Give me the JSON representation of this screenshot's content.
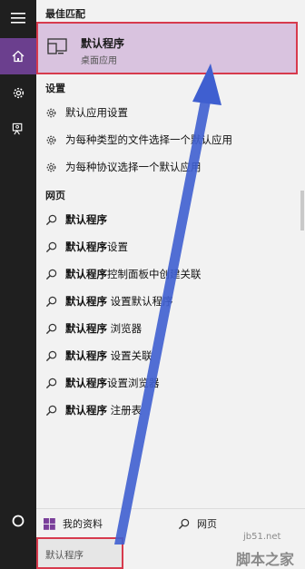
{
  "best_match": {
    "heading": "最佳匹配",
    "title": "默认程序",
    "subtitle": "桌面应用"
  },
  "settings": {
    "heading": "设置",
    "items": [
      {
        "label": "默认应用设置"
      },
      {
        "label": "为每种类型的文件选择一个默认应用"
      },
      {
        "label": "为每种协议选择一个默认应用"
      }
    ]
  },
  "web": {
    "heading": "网页",
    "items": [
      {
        "bold": "默认程序",
        "rest": ""
      },
      {
        "bold": "默认程序",
        "rest": "设置"
      },
      {
        "bold": "默认程序",
        "rest": "控制面板中创建关联"
      },
      {
        "bold": "默认程序",
        "rest": " 设置默认程序"
      },
      {
        "bold": "默认程序",
        "rest": " 浏览器"
      },
      {
        "bold": "默认程序",
        "rest": " 设置关联"
      },
      {
        "bold": "默认程序",
        "rest": "设置浏览器"
      },
      {
        "bold": "默认程序",
        "rest": " 注册表"
      }
    ]
  },
  "bottom": {
    "my_stuff": "我的资料",
    "web_label": "网页"
  },
  "search": {
    "query": "默认程序"
  },
  "watermark": {
    "url": "jb51.net",
    "name": "脚本之家"
  },
  "colors": {
    "accent": "#6b3f8e",
    "highlight": "#d9c3df",
    "annotation_red": "#d73a4d",
    "annotation_blue": "#3f5fd0"
  },
  "icons": [
    "hamburger-icon",
    "home-icon",
    "gear-icon",
    "feedback-icon",
    "cortana-circle-icon",
    "desktop-app-icon",
    "search-icon",
    "windows-logo-icon"
  ]
}
